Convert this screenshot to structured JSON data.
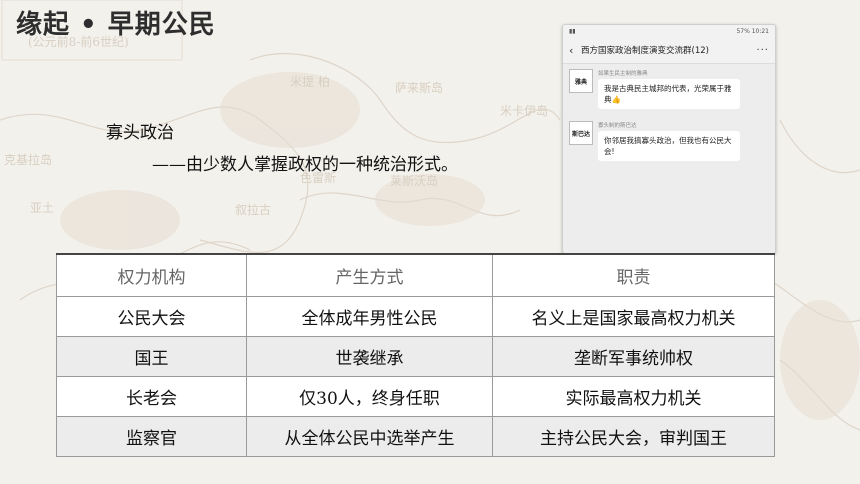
{
  "title": "缘起 • 早期公民",
  "concept": {
    "term": "寡头政治",
    "definition": "——由少数人掌握政权的一种统治形式。"
  },
  "map_labels": [
    "米提 柏",
    "萨来斯岛",
    "莱斯沃岛",
    "克基拉岛",
    "亚土",
    "米卡伊岛",
    "色雷斯",
    "叙拉古",
    "(公元前8-前6世纪)"
  ],
  "phone": {
    "status_left": "▮▮ ",
    "status_right": "57% 10:21",
    "chat_title": "西方国家政治制度演变交流群(12)",
    "back_glyph": "‹",
    "more_glyph": "···",
    "messages": [
      {
        "avatar": "雅典",
        "sender": "如果生民主制的雅典",
        "text": "我是古典民主城邦的代表，光荣属于雅典👍"
      },
      {
        "avatar": "斯巴达",
        "sender": "寡头制的斯巴达",
        "text": "你邻居我搞寡头政治，但我也有公民大会!"
      }
    ]
  },
  "table": {
    "headers": [
      "权力机构",
      "产生方式",
      "职责"
    ],
    "rows": [
      [
        "公民大会",
        "全体成年男性公民",
        "名义上是国家最高权力机关"
      ],
      [
        "国王",
        "世袭继承",
        "垄断军事统帅权"
      ],
      [
        "长老会",
        "仅30人，终身任职",
        "实际最高权力机关"
      ],
      [
        "监察官",
        "从全体公民中选举产生",
        "主持公民大会，审判国王"
      ]
    ]
  },
  "colors": {
    "background": "#f3f1ec",
    "map_line": "#d9cfc2",
    "table_border": "#9a9a9a",
    "row_gray": "#ececec"
  }
}
